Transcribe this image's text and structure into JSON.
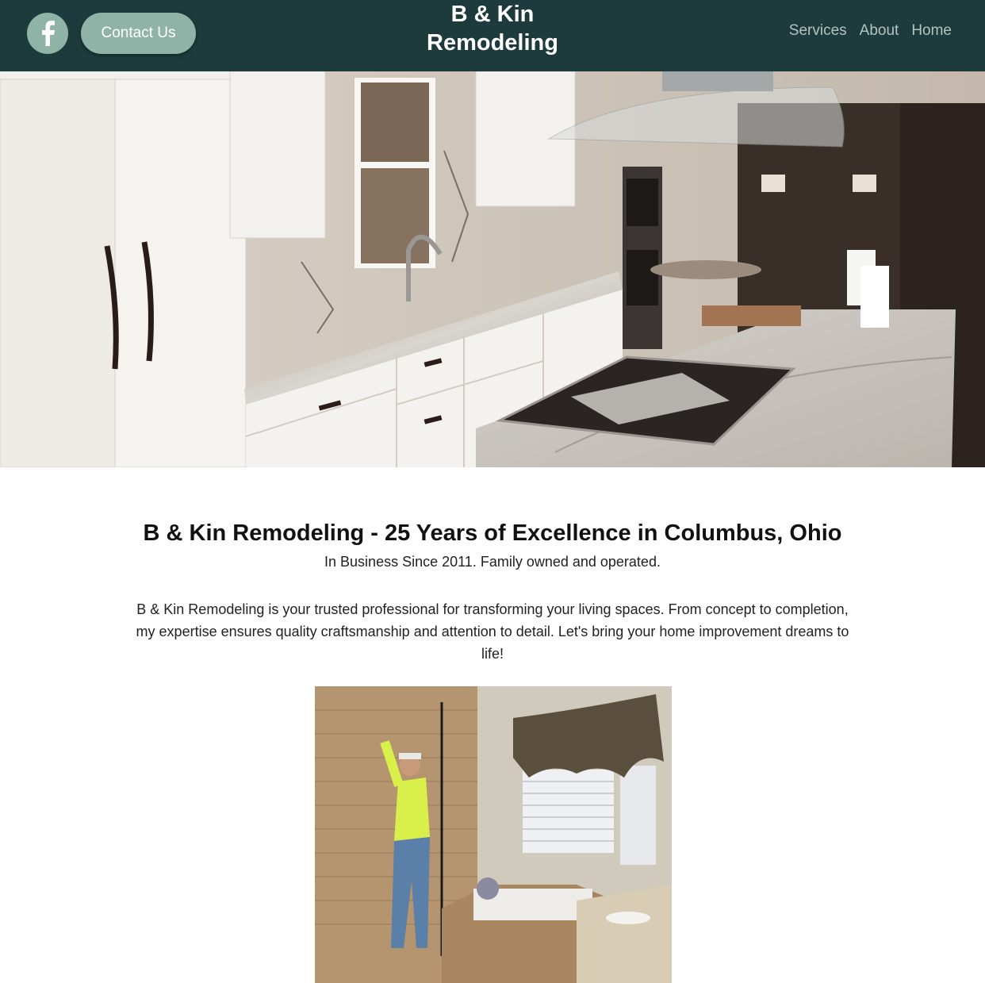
{
  "header": {
    "facebook_icon": "facebook-icon",
    "contact_label": "Contact Us",
    "brand_line1": "B & Kin",
    "brand_line2": "Remodeling",
    "nav": [
      {
        "label": "Services"
      },
      {
        "label": "About"
      },
      {
        "label": "Home"
      }
    ]
  },
  "main": {
    "headline": "B & Kin Remodeling - 25 Years of Excellence in Columbus, Ohio",
    "subline": "In Business Since 2011. Family owned and operated.",
    "paragraph": "B & Kin Remodeling is your trusted professional for transforming your living spaces. From concept to completion, my expertise ensures quality craftsmanship and attention to detail. Let's bring your home improvement dreams to life!"
  },
  "colors": {
    "header_bg": "#1d3b3c",
    "button_bg": "#8fb3a6",
    "nav_text": "#b3c3bd"
  }
}
